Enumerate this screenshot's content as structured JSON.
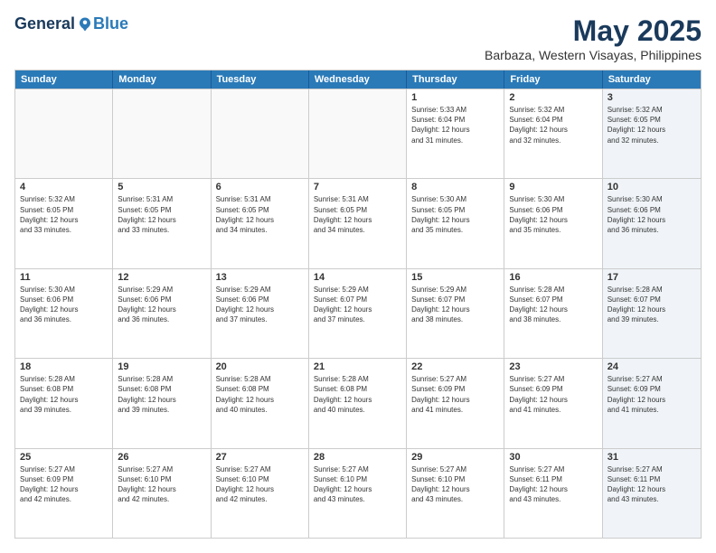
{
  "header": {
    "logo_general": "General",
    "logo_blue": "Blue",
    "month_title": "May 2025",
    "location": "Barbaza, Western Visayas, Philippines"
  },
  "days_of_week": [
    "Sunday",
    "Monday",
    "Tuesday",
    "Wednesday",
    "Thursday",
    "Friday",
    "Saturday"
  ],
  "rows": [
    [
      {
        "date": "",
        "info": "",
        "empty": true
      },
      {
        "date": "",
        "info": "",
        "empty": true
      },
      {
        "date": "",
        "info": "",
        "empty": true
      },
      {
        "date": "",
        "info": "",
        "empty": true
      },
      {
        "date": "1",
        "info": "Sunrise: 5:33 AM\nSunset: 6:04 PM\nDaylight: 12 hours\nand 31 minutes.",
        "empty": false
      },
      {
        "date": "2",
        "info": "Sunrise: 5:32 AM\nSunset: 6:04 PM\nDaylight: 12 hours\nand 32 minutes.",
        "empty": false
      },
      {
        "date": "3",
        "info": "Sunrise: 5:32 AM\nSunset: 6:05 PM\nDaylight: 12 hours\nand 32 minutes.",
        "empty": false,
        "shaded": true
      }
    ],
    [
      {
        "date": "4",
        "info": "Sunrise: 5:32 AM\nSunset: 6:05 PM\nDaylight: 12 hours\nand 33 minutes.",
        "empty": false
      },
      {
        "date": "5",
        "info": "Sunrise: 5:31 AM\nSunset: 6:05 PM\nDaylight: 12 hours\nand 33 minutes.",
        "empty": false
      },
      {
        "date": "6",
        "info": "Sunrise: 5:31 AM\nSunset: 6:05 PM\nDaylight: 12 hours\nand 34 minutes.",
        "empty": false
      },
      {
        "date": "7",
        "info": "Sunrise: 5:31 AM\nSunset: 6:05 PM\nDaylight: 12 hours\nand 34 minutes.",
        "empty": false
      },
      {
        "date": "8",
        "info": "Sunrise: 5:30 AM\nSunset: 6:05 PM\nDaylight: 12 hours\nand 35 minutes.",
        "empty": false
      },
      {
        "date": "9",
        "info": "Sunrise: 5:30 AM\nSunset: 6:06 PM\nDaylight: 12 hours\nand 35 minutes.",
        "empty": false
      },
      {
        "date": "10",
        "info": "Sunrise: 5:30 AM\nSunset: 6:06 PM\nDaylight: 12 hours\nand 36 minutes.",
        "empty": false,
        "shaded": true
      }
    ],
    [
      {
        "date": "11",
        "info": "Sunrise: 5:30 AM\nSunset: 6:06 PM\nDaylight: 12 hours\nand 36 minutes.",
        "empty": false
      },
      {
        "date": "12",
        "info": "Sunrise: 5:29 AM\nSunset: 6:06 PM\nDaylight: 12 hours\nand 36 minutes.",
        "empty": false
      },
      {
        "date": "13",
        "info": "Sunrise: 5:29 AM\nSunset: 6:06 PM\nDaylight: 12 hours\nand 37 minutes.",
        "empty": false
      },
      {
        "date": "14",
        "info": "Sunrise: 5:29 AM\nSunset: 6:07 PM\nDaylight: 12 hours\nand 37 minutes.",
        "empty": false
      },
      {
        "date": "15",
        "info": "Sunrise: 5:29 AM\nSunset: 6:07 PM\nDaylight: 12 hours\nand 38 minutes.",
        "empty": false
      },
      {
        "date": "16",
        "info": "Sunrise: 5:28 AM\nSunset: 6:07 PM\nDaylight: 12 hours\nand 38 minutes.",
        "empty": false
      },
      {
        "date": "17",
        "info": "Sunrise: 5:28 AM\nSunset: 6:07 PM\nDaylight: 12 hours\nand 39 minutes.",
        "empty": false,
        "shaded": true
      }
    ],
    [
      {
        "date": "18",
        "info": "Sunrise: 5:28 AM\nSunset: 6:08 PM\nDaylight: 12 hours\nand 39 minutes.",
        "empty": false
      },
      {
        "date": "19",
        "info": "Sunrise: 5:28 AM\nSunset: 6:08 PM\nDaylight: 12 hours\nand 39 minutes.",
        "empty": false
      },
      {
        "date": "20",
        "info": "Sunrise: 5:28 AM\nSunset: 6:08 PM\nDaylight: 12 hours\nand 40 minutes.",
        "empty": false
      },
      {
        "date": "21",
        "info": "Sunrise: 5:28 AM\nSunset: 6:08 PM\nDaylight: 12 hours\nand 40 minutes.",
        "empty": false
      },
      {
        "date": "22",
        "info": "Sunrise: 5:27 AM\nSunset: 6:09 PM\nDaylight: 12 hours\nand 41 minutes.",
        "empty": false
      },
      {
        "date": "23",
        "info": "Sunrise: 5:27 AM\nSunset: 6:09 PM\nDaylight: 12 hours\nand 41 minutes.",
        "empty": false
      },
      {
        "date": "24",
        "info": "Sunrise: 5:27 AM\nSunset: 6:09 PM\nDaylight: 12 hours\nand 41 minutes.",
        "empty": false,
        "shaded": true
      }
    ],
    [
      {
        "date": "25",
        "info": "Sunrise: 5:27 AM\nSunset: 6:09 PM\nDaylight: 12 hours\nand 42 minutes.",
        "empty": false
      },
      {
        "date": "26",
        "info": "Sunrise: 5:27 AM\nSunset: 6:10 PM\nDaylight: 12 hours\nand 42 minutes.",
        "empty": false
      },
      {
        "date": "27",
        "info": "Sunrise: 5:27 AM\nSunset: 6:10 PM\nDaylight: 12 hours\nand 42 minutes.",
        "empty": false
      },
      {
        "date": "28",
        "info": "Sunrise: 5:27 AM\nSunset: 6:10 PM\nDaylight: 12 hours\nand 43 minutes.",
        "empty": false
      },
      {
        "date": "29",
        "info": "Sunrise: 5:27 AM\nSunset: 6:10 PM\nDaylight: 12 hours\nand 43 minutes.",
        "empty": false
      },
      {
        "date": "30",
        "info": "Sunrise: 5:27 AM\nSunset: 6:11 PM\nDaylight: 12 hours\nand 43 minutes.",
        "empty": false
      },
      {
        "date": "31",
        "info": "Sunrise: 5:27 AM\nSunset: 6:11 PM\nDaylight: 12 hours\nand 43 minutes.",
        "empty": false,
        "shaded": true
      }
    ]
  ]
}
